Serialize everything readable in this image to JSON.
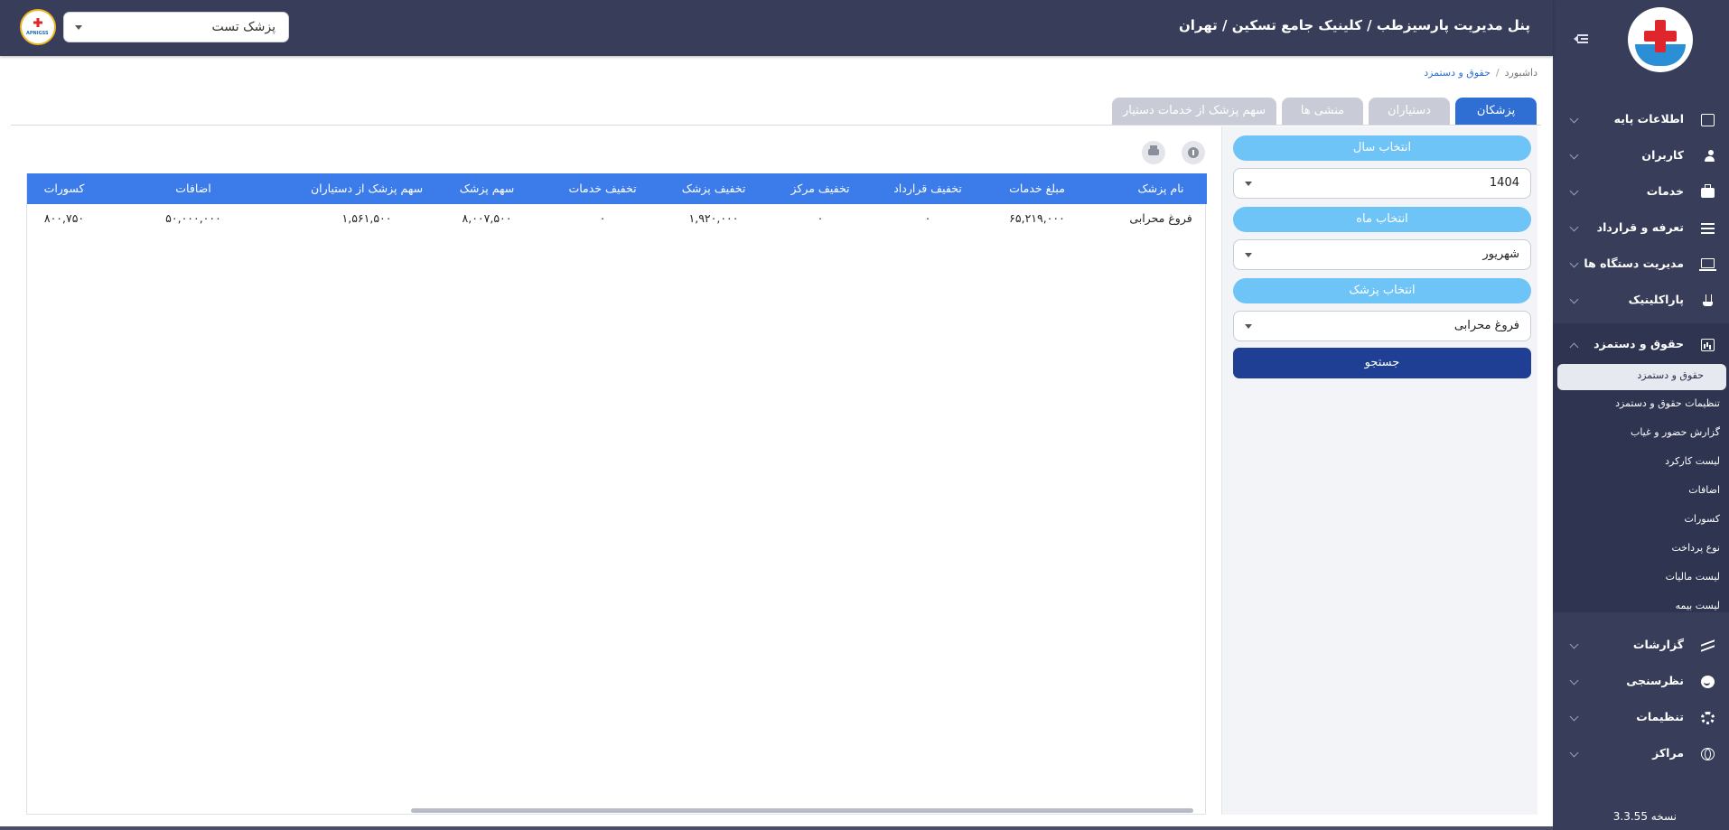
{
  "sidebar": {
    "version": "نسخه 3.3.55",
    "menu": [
      {
        "label": "اطلاعات پایه",
        "icon": "id-card-icon",
        "expanded": false
      },
      {
        "label": "کاربران",
        "icon": "users-icon",
        "expanded": false
      },
      {
        "label": "خدمات",
        "icon": "medkit-icon",
        "expanded": false
      },
      {
        "label": "تعرفه و قرارداد",
        "icon": "tariff-icon",
        "expanded": false
      },
      {
        "label": "مدیریت دستگاه ها",
        "icon": "device-icon",
        "expanded": false
      },
      {
        "label": "پاراکلینیک",
        "icon": "microscope-icon",
        "expanded": false
      },
      {
        "label": "حقوق و دستمزد",
        "icon": "chart-icon",
        "expanded": true
      },
      {
        "label": "گزارشات",
        "icon": "report-icon",
        "expanded": false
      },
      {
        "label": "نظرسنجی",
        "icon": "smile-icon",
        "expanded": false
      },
      {
        "label": "تنظیمات",
        "icon": "gear-icon",
        "expanded": false
      },
      {
        "label": "مراکز",
        "icon": "globe-icon",
        "expanded": false
      }
    ],
    "submenu": [
      "حقوق و دستمزد",
      "تنظیمات حقوق و دستمزد",
      "گزارش حضور و غیاب",
      "لیست کارکرد",
      "اضافات",
      "کسورات",
      "نوع پرداخت",
      "لیست مالیات",
      "لیست بیمه"
    ]
  },
  "topbar": {
    "title": "پنل مدیریت پارسیزطب / کلینیک جامع تسکین / تهران",
    "user_select": "پزشک تست",
    "avatar_text": "APNIGSS"
  },
  "breadcrumb": {
    "home": "داشبورد",
    "separator": "/",
    "current": "حقوق و دستمزد"
  },
  "tabs": [
    {
      "label": "پزشکان",
      "active": true
    },
    {
      "label": "دستیاران",
      "active": false
    },
    {
      "label": "منشی ها",
      "active": false
    },
    {
      "label": "سهم پزشک از خدمات دستیار",
      "active": false
    }
  ],
  "filters": {
    "year_label": "انتخاب سال",
    "year_value": "1404",
    "month_label": "انتخاب ماه",
    "month_value": "شهریور",
    "doctor_label": "انتخاب پزشک",
    "doctor_value": "فروغ محرابی",
    "search_button": "جستجو"
  },
  "table": {
    "headers": [
      "نام پزشک",
      "مبلغ خدمات",
      "تخفیف قرارداد",
      "تخفیف مرکز",
      "تخفیف پزشک",
      "تخفیف خدمات",
      "سهم پزشک",
      "سهم پزشک از دستیاران",
      "اضافات",
      "کسورات"
    ],
    "rows": [
      [
        "فروغ محرابی",
        "۶۵,۲۱۹,۰۰۰",
        "۰",
        "۰",
        "۱,۹۲۰,۰۰۰",
        "۰",
        "۸,۰۰۷,۵۰۰",
        "۱,۵۶۱,۵۰۰",
        "۵۰,۰۰۰,۰۰۰",
        "۸۰۰,۷۵۰"
      ]
    ]
  },
  "colors": {
    "sidebar_bg": "#383d59",
    "accent_blue": "#2f6fd4",
    "table_header": "#3b7bea",
    "filter_pill": "#6ec4f7",
    "search_button": "#1f3f94"
  }
}
